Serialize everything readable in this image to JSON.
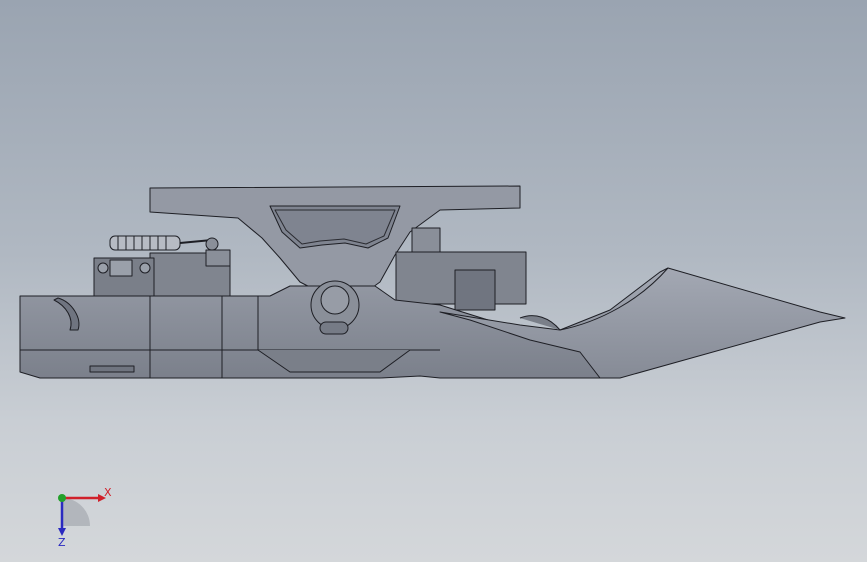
{
  "viewport": {
    "background_top": "#9aa4b1",
    "background_bottom": "#d4d7da"
  },
  "model": {
    "part_color": "#8e939f",
    "edge_color": "#1e1f25",
    "shade_color": "#6f7480",
    "highlight_color": "#a9adb8"
  },
  "triad": {
    "x_label": "X",
    "z_label": "Z",
    "x_color": "#d0202a",
    "y_color": "#22a02a",
    "z_color": "#2a2ac0"
  }
}
